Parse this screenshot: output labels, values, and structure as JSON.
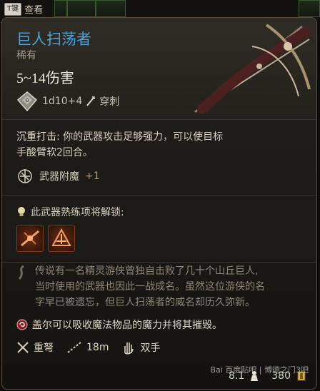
{
  "topbar": {
    "key_badge": "T键",
    "label": "查看"
  },
  "item": {
    "name": "巨人扫荡者",
    "rarity": "稀有",
    "damage": "5~14伤害",
    "dice": "1d10+4",
    "damage_type": "穿刺",
    "name_color": "#45a3e0"
  },
  "action": {
    "name": "沉重打击:",
    "desc_line1": "你的武器攻击足够强力，可以使目标",
    "desc_line2": "手酸臂软2回合。"
  },
  "enchant": {
    "label": "武器附魔",
    "value": "+1"
  },
  "unlock": {
    "label": "此武器熟练项将解锁:"
  },
  "lore": {
    "line1": "传说有一名精灵游侠曾独自击败了几十个山丘巨人,",
    "line2": "当时使用的武器也因此一战成名。虽然这位游侠的名",
    "line3": "字早已被遗忘，但巨人扫荡者的威名却历久弥新。"
  },
  "absorb": {
    "text": "盖尔可以吸收魔法物品的魔力并将其摧毁。"
  },
  "props": {
    "weapon_type": "重弩",
    "range": "18m",
    "hands": "双手"
  },
  "footer": {
    "weight": "8.1",
    "price": "380"
  },
  "watermark": "Bai 百度贴吧 | 博德之门3吧",
  "icons": [
    "d10-dice-icon",
    "piercing-icon",
    "enchant-icon",
    "lightbulb-icon",
    "skill-icon",
    "lore-icon",
    "absorb-icon",
    "crossbow-icon",
    "range-icon",
    "hand-icon",
    "weight-icon",
    "coin-icon"
  ]
}
